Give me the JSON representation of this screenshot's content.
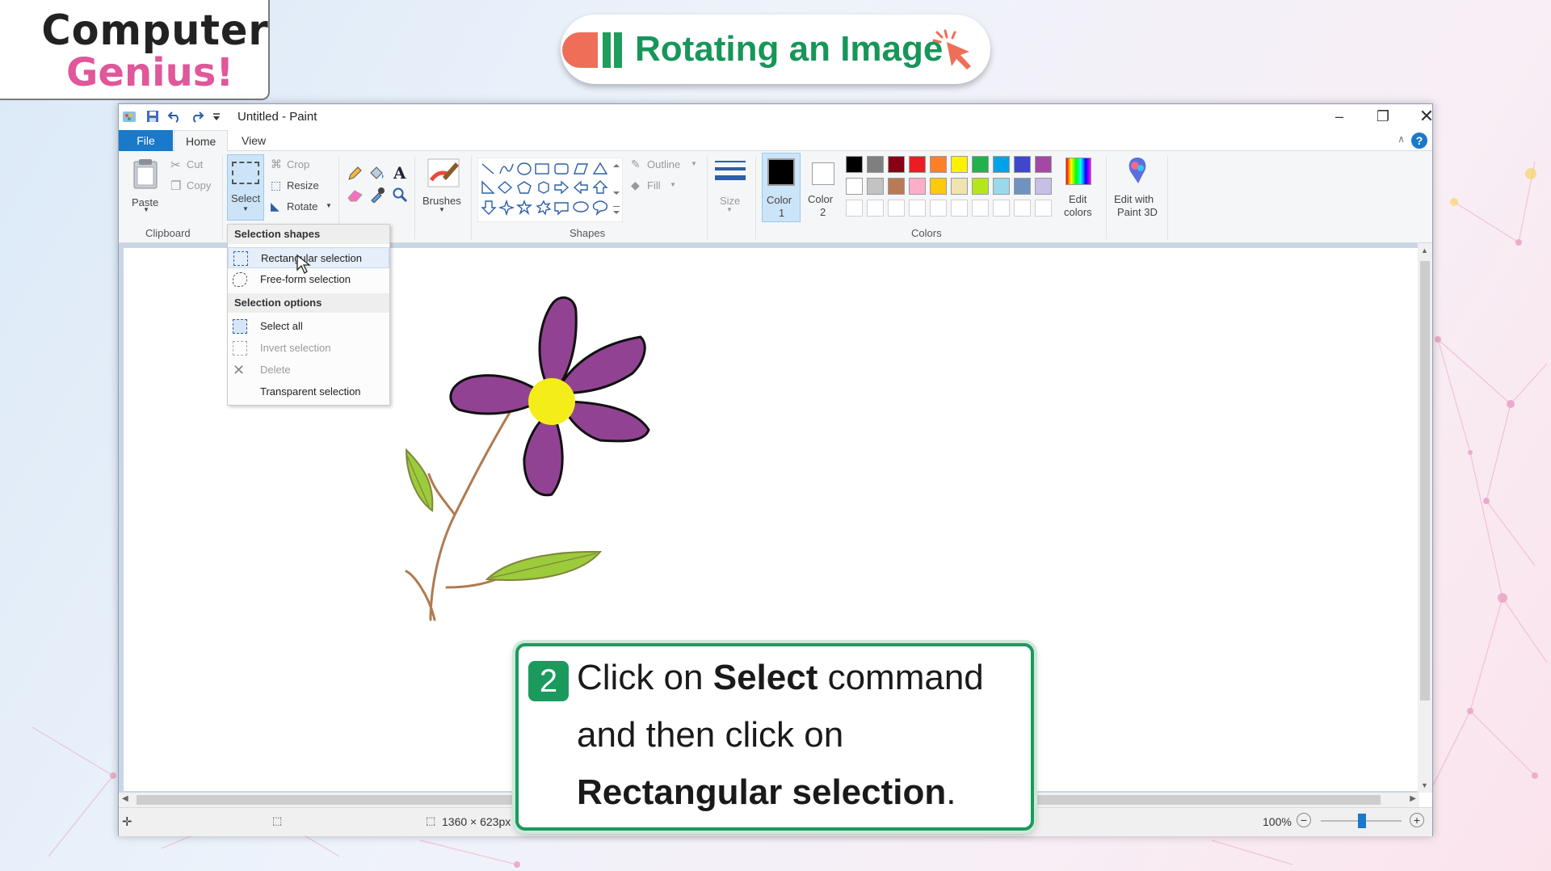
{
  "logo": {
    "line1": "Computer",
    "line2": "Genius!"
  },
  "slide_title": "Rotating an Image",
  "window": {
    "title": "Untitled - Paint"
  },
  "tabs": {
    "file": "File",
    "home": "Home",
    "view": "View"
  },
  "ribbon": {
    "clipboard": {
      "paste": "Paste",
      "cut": "Cut",
      "copy": "Copy",
      "group": "Clipboard"
    },
    "image": {
      "select": "Select",
      "crop": "Crop",
      "resize": "Resize",
      "rotate": "Rotate"
    },
    "brushes": "Brushes",
    "shapes": {
      "outline": "Outline",
      "fill": "Fill",
      "group": "Shapes"
    },
    "size": "Size",
    "colors": {
      "color1": "Color\n1",
      "color1_a": "Color",
      "color1_b": "1",
      "color2_a": "Color",
      "color2_b": "2",
      "edit_colors_a": "Edit",
      "edit_colors_b": "colors",
      "paint3d_a": "Edit with",
      "paint3d_b": "Paint 3D",
      "group": "Colors",
      "palette_row1": [
        "#000000",
        "#7f7f7f",
        "#880015",
        "#ed1c24",
        "#ff7f27",
        "#fff200",
        "#22b14c",
        "#00a2e8",
        "#3f48cc",
        "#a349a4"
      ],
      "palette_row2": [
        "#ffffff",
        "#c3c3c3",
        "#b97a57",
        "#ffaec9",
        "#ffc90e",
        "#efe4b0",
        "#b5e61d",
        "#99d9ea",
        "#7092be",
        "#c8bfe7"
      ]
    }
  },
  "dropdown": {
    "section1": "Selection shapes",
    "rectangular": "Rectangular selection",
    "freeform": "Free-form selection",
    "section2": "Selection options",
    "select_all": "Select all",
    "invert": "Invert selection",
    "delete": "Delete",
    "transparent": "Transparent selection"
  },
  "status": {
    "dimensions": "1360 × 623px",
    "zoom": "100%"
  },
  "callout": {
    "step": "2",
    "line1_pre": "Click on ",
    "line1_bold": "Select",
    "line1_post": " command",
    "line2": "and then click on",
    "line3_bold": "Rectangular selection",
    "line3_post": "."
  }
}
